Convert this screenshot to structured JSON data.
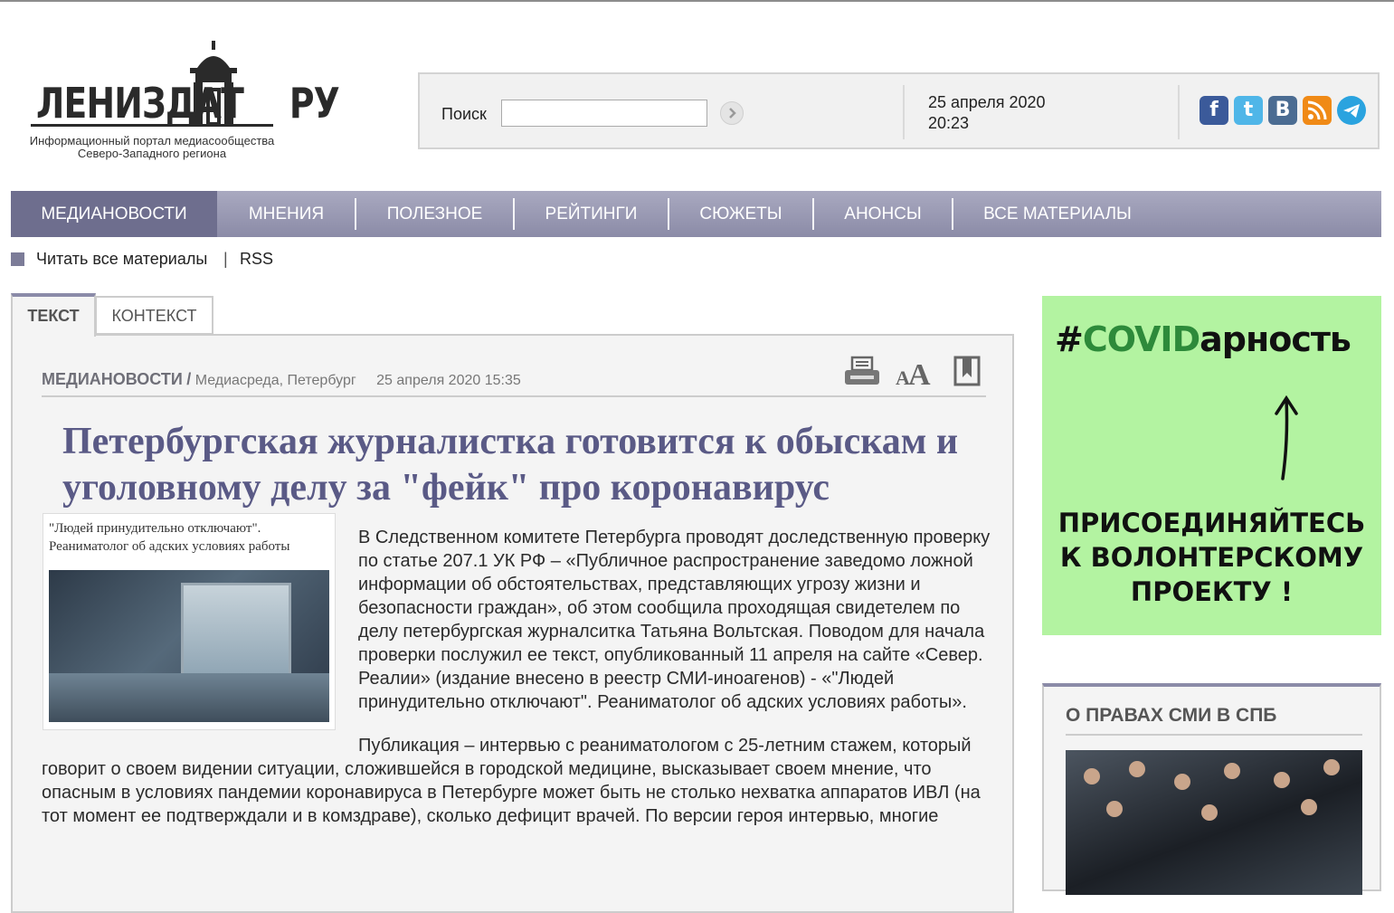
{
  "logo": {
    "word_left": "ЛЕНИЗДАТ",
    "word_right": "РУ",
    "subtitle_line1": "Информационный портал медиасообщества",
    "subtitle_line2": "Северо-Западного региона"
  },
  "header": {
    "search_label": "Поиск",
    "search_value": "",
    "date": "25 апреля 2020",
    "time": "20:23",
    "socials": [
      "facebook-icon",
      "twitter-icon",
      "vk-icon",
      "rss-icon",
      "telegram-icon"
    ]
  },
  "nav": {
    "items": [
      {
        "label": "МЕДИАНОВОСТИ",
        "active": true
      },
      {
        "label": "МНЕНИЯ"
      },
      {
        "label": "ПОЛЕЗНОЕ"
      },
      {
        "label": "РЕЙТИНГИ"
      },
      {
        "label": "СЮЖЕТЫ"
      },
      {
        "label": "АНОНСЫ"
      },
      {
        "label": "ВСЕ МАТЕРИАЛЫ"
      }
    ]
  },
  "subline": {
    "read_all": "Читать все материалы",
    "separator": "|",
    "rss": "RSS"
  },
  "tabs": {
    "text": "ТЕКСТ",
    "context": "КОНТЕКСТ"
  },
  "article": {
    "rubric": "МЕДИАНОВОСТИ",
    "rubric_sep": "/",
    "tags": "Медиасреда, Петербург",
    "date": "25 апреля 2020 15:35",
    "title": "Петербургская журналистка готовится к обыскам и уголовному делу за \"фейк\" про коронавирус",
    "figure_caption_line1": "\"Людей принудительно отключают\".",
    "figure_caption_line2": "Реаниматолог об адских условиях работы",
    "paragraph1": "В Следственном комитете Петербурга проводят доследственную проверку по статье 207.1 УК РФ – «Публичное распространение заведомо ложной информации об обстоятельствах, представляющих угрозу жизни и безопасности граждан», об этом сообщила проходящая свидетелем по делу петербургская журналситка Татьяна Вольтская. Поводом для начала проверки послужил ее текст, опубликованный 11 апреля на сайте «Север. Реалии» (издание внесено в реестр СМИ-иноагенов) - «\"Людей принудительно отключают\". Реаниматолог об адских условиях работы».",
    "paragraph2": "Публикация – интервью с реаниматологом с 25-летним стажем, который говорит о своем видении ситуации, сложившейся в городской медицине, высказывает своем мнение, что опасным в условиях пандемии коронавируса в Петербурге может быть не столько нехватка аппаратов ИВЛ (на тот момент ее подтверждали и в комздраве), сколько дефицит врачей. По версии героя интервью, многие"
  },
  "covid_banner": {
    "hash": "#",
    "tag_part1": "CO",
    "tag_part2": "VID",
    "tag_part3": "арность",
    "join_line1": "Присоединяйтесь",
    "join_line2": "к волонтерскому",
    "join_line3": "проекту !",
    "colors": {
      "bg": "#b3f3a1",
      "accent": "#2d8a3a"
    }
  },
  "rights": {
    "title": "О ПРАВАХ СМИ В СПБ"
  }
}
